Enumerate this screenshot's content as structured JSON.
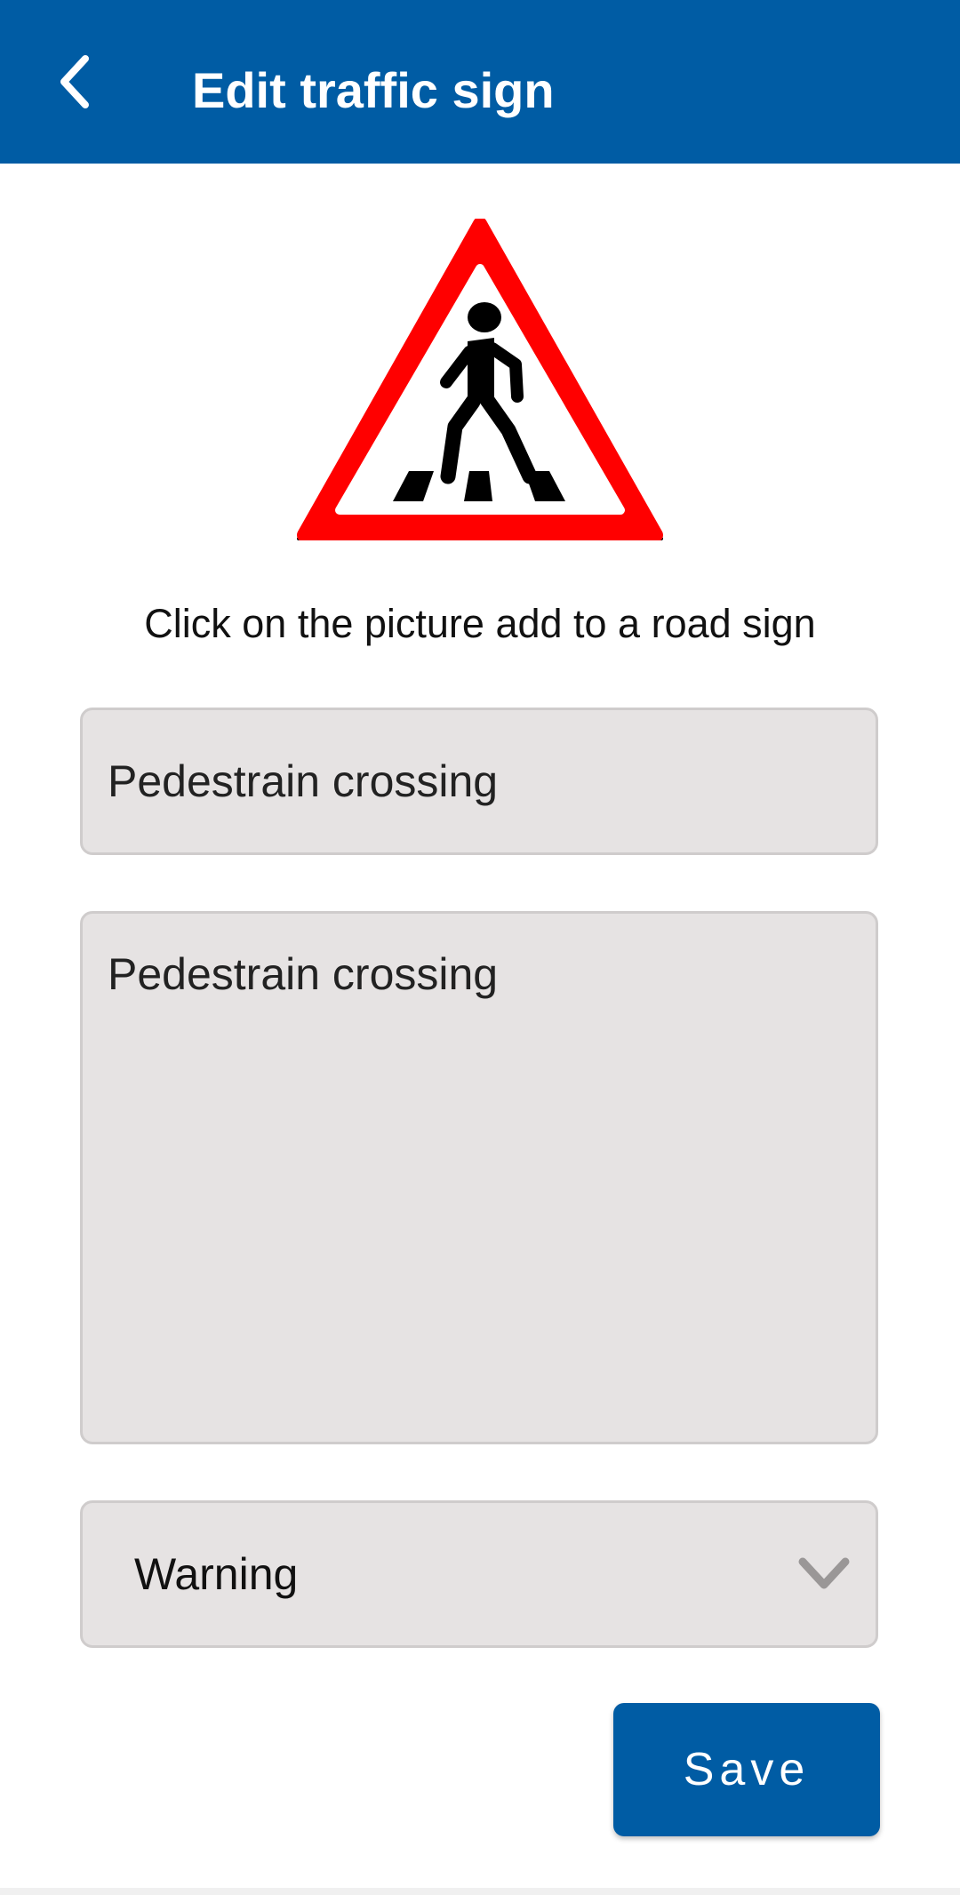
{
  "app_bar": {
    "title": "Edit traffic sign",
    "back_icon": "chevron-left-icon",
    "color": "#005ca4"
  },
  "sign": {
    "icon": "pedestrian-crossing-sign",
    "border_color": "#ff0000"
  },
  "hint": "Click on the picture add to a road sign",
  "form": {
    "name_value": "Pedestrain crossing",
    "description_value": "Pedestrain crossing",
    "type_selected": "Warning",
    "dropdown_icon": "chevron-down-icon"
  },
  "actions": {
    "save_label": "Save"
  }
}
